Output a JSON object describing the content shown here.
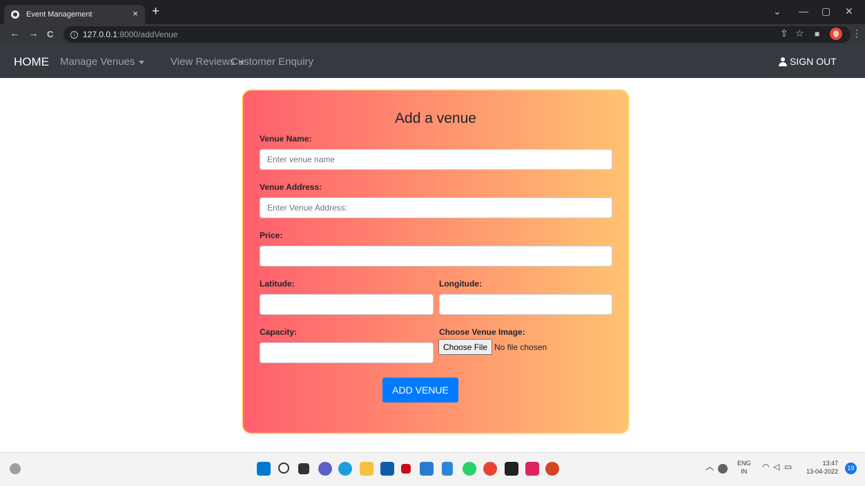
{
  "browser": {
    "tab_title": "Event Management",
    "tab_close": "×",
    "new_tab": "+",
    "url_host": "127.0.0.1",
    "url_path": ":8000/addVenue",
    "back": "←",
    "forward": "→",
    "reload": "C"
  },
  "navbar": {
    "home": "HOME",
    "manage_venues": "Manage Venues",
    "view_reviews": "View Reviews",
    "customer_enquiry": "Customer Enquiry",
    "sign_out": "SIGN OUT"
  },
  "form": {
    "title": "Add a venue",
    "venue_name_label": "Venue Name:",
    "venue_name_placeholder": "Enter venue name",
    "venue_address_label": "Venue Address:",
    "venue_address_placeholder": "Enter Venue Address:",
    "price_label": "Price:",
    "latitude_label": "Latitude:",
    "longitude_label": "Longitude:",
    "capacity_label": "Capacity:",
    "image_label": "Choose Venue Image:",
    "choose_file": "Choose File",
    "no_file": "No file chosen",
    "submit": "ADD VENUE"
  },
  "taskbar": {
    "lang_top": "ENG",
    "lang_bottom": "IN",
    "time": "13:47",
    "date": "13-04-2022",
    "notification_count": "19"
  },
  "colors": {
    "gradient_start": "#ff5f6d",
    "gradient_end": "#ffc371",
    "button": "#007bff",
    "navbar": "#343a40"
  }
}
